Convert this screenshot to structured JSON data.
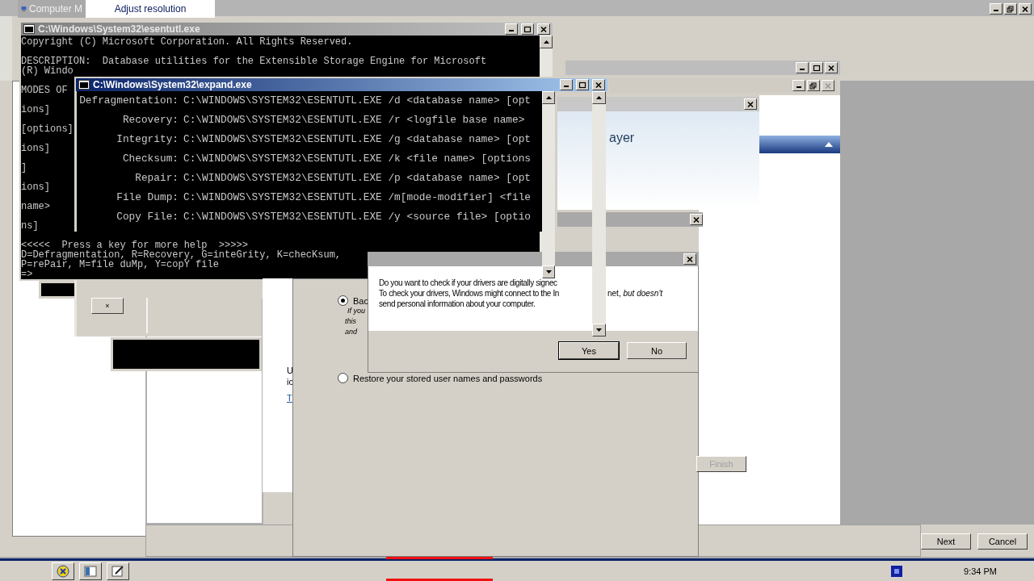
{
  "top_tabs": [
    {
      "label": "Computer M",
      "selected": false
    },
    {
      "label": "Adjust resolution",
      "selected": true
    }
  ],
  "esentutl_window": {
    "title": "C:\\Windows\\System32\\esentutl.exe",
    "active": false,
    "paragraphs": [
      [
        "Copyright (C) Microsoft Corporation. All Rights Reserved."
      ],
      [
        "DESCRIPTION:  Database utilities for the Extensible Storage Engine for Microsoft",
        "(R) Windo"
      ],
      [
        "MODES OF"
      ],
      [
        "ions]"
      ],
      [
        "[options]"
      ],
      [
        "ions]"
      ],
      [
        "]"
      ],
      [
        "ions]"
      ],
      [
        "name>"
      ],
      [
        "ns]"
      ],
      [
        "<<<<<  Press a key for more help  >>>>>",
        "D=Defragmentation, R=Recovery, G=inteGrity, K=checKsum,",
        "P=rePair, M=file duMp, Y=copY file",
        "=>"
      ]
    ]
  },
  "expand_window": {
    "title": "C:\\Windows\\System32\\expand.exe",
    "active": true,
    "modes": [
      {
        "label": "Defragmentation:",
        "command": "C:\\WINDOWS\\SYSTEM32\\ESENTUTL.EXE /d <database name> [opt"
      },
      {
        "label": "Recovery:",
        "command": "C:\\WINDOWS\\SYSTEM32\\ESENTUTL.EXE /r <logfile base name>"
      },
      {
        "label": "Integrity:",
        "command": "C:\\WINDOWS\\SYSTEM32\\ESENTUTL.EXE /g <database name> [opt"
      },
      {
        "label": "Checksum:",
        "command": "C:\\WINDOWS\\SYSTEM32\\ESENTUTL.EXE /k <file name> [options"
      },
      {
        "label": "Repair:",
        "command": "C:\\WINDOWS\\SYSTEM32\\ESENTUTL.EXE /p <database name> [opt"
      },
      {
        "label": "File Dump:",
        "command": "C:\\WINDOWS\\SYSTEM32\\ESENTUTL.EXE /m[mode-modifier] <file"
      },
      {
        "label": "Copy File:",
        "command": "C:\\WINDOWS\\SYSTEM32\\ESENTUTL.EXE /y <source file> [optio"
      }
    ],
    "footer_button": "×"
  },
  "media_dialog": {
    "heading": "ayer"
  },
  "driver_dialog": {
    "lines": [
      {
        "text": "Do you want to check if your drivers are digitally signec"
      },
      {
        "text": "To check your drivers, Windows might connect to the In",
        "continuation": "net, *but doesn't*"
      },
      {
        "text": "send personal information about your computer."
      }
    ],
    "buttons": [
      {
        "label": "Yes",
        "default": true
      },
      {
        "label": "No",
        "default": false
      }
    ]
  },
  "wizard": {
    "options": [
      {
        "label": "Bac",
        "checked": true,
        "notes": [
          "If you",
          "this",
          "and"
        ]
      },
      {
        "label": "Restore your stored user names and passwords",
        "checked": false
      }
    ],
    "side_text": [
      "U",
      "ic"
    ],
    "link": "T",
    "finish_button": {
      "label": "Finish",
      "disabled": true
    },
    "buttons": [
      "Next",
      "Cancel"
    ]
  },
  "taskbar": {
    "clock": "9:34 PM"
  }
}
